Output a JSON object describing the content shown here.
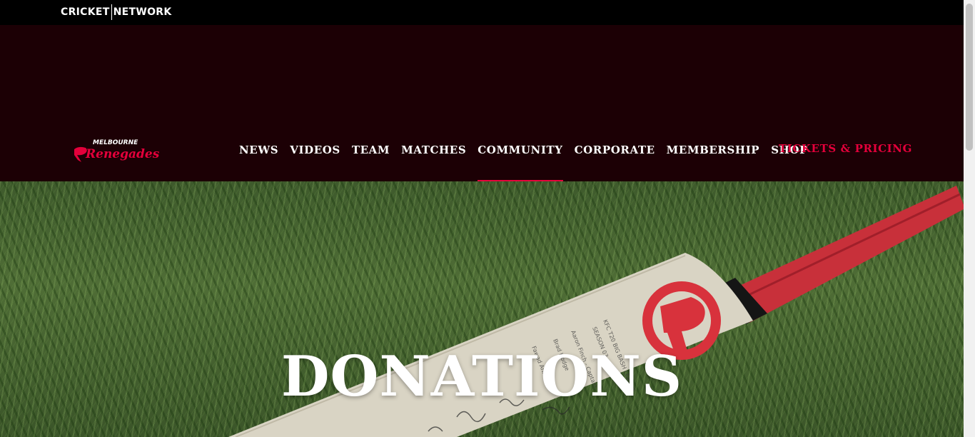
{
  "network": {
    "brand_left": "CRICKET",
    "brand_right": "NETWORK"
  },
  "header": {
    "logo_top": "MELBOURNE",
    "logo_main": "Renegades",
    "nav": [
      {
        "label": "NEWS"
      },
      {
        "label": "VIDEOS"
      },
      {
        "label": "TEAM"
      },
      {
        "label": "MATCHES"
      },
      {
        "label": "COMMUNITY",
        "active": true
      },
      {
        "label": "CORPORATE"
      },
      {
        "label": "MEMBERSHIP"
      },
      {
        "label": "SHOP"
      }
    ],
    "tickets_label": "TICKETS & PRICING"
  },
  "hero": {
    "title": "DONATIONS"
  },
  "colors": {
    "accent": "#e4003b",
    "header_bg": "#1c0005",
    "network_bar_bg": "#000000"
  },
  "icons": {
    "club_logo": "renegades-logo",
    "bat_emblem": "renegades-r-emblem"
  }
}
